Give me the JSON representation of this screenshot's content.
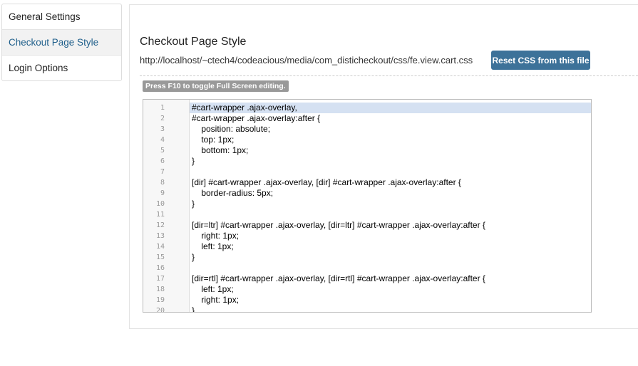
{
  "sidebar": {
    "items": [
      {
        "label": "General Settings",
        "active": false
      },
      {
        "label": "Checkout Page Style",
        "active": true
      },
      {
        "label": "Login Options",
        "active": false
      }
    ]
  },
  "main": {
    "title": "Checkout Page Style",
    "file_path": "http://localhost/~ctech4/codeacious/media/com_disticheckout/css/fe.view.cart.css",
    "reset_button_label": "Reset CSS from this file",
    "hint": "Press F10 to toggle Full Screen editing.",
    "editor": {
      "highlighted_line": 1,
      "lines": [
        {
          "number": "1",
          "text": "#cart-wrapper .ajax-overlay,"
        },
        {
          "number": "2",
          "text": "#cart-wrapper .ajax-overlay:after {"
        },
        {
          "number": "3",
          "text": "    position: absolute;"
        },
        {
          "number": "4",
          "text": "    top: 1px;"
        },
        {
          "number": "5",
          "text": "    bottom: 1px;"
        },
        {
          "number": "6",
          "text": "}"
        },
        {
          "number": "7",
          "text": ""
        },
        {
          "number": "8",
          "text": "[dir] #cart-wrapper .ajax-overlay, [dir] #cart-wrapper .ajax-overlay:after {"
        },
        {
          "number": "9",
          "text": "    border-radius: 5px;"
        },
        {
          "number": "10",
          "text": "}"
        },
        {
          "number": "11",
          "text": ""
        },
        {
          "number": "12",
          "text": "[dir=ltr] #cart-wrapper .ajax-overlay, [dir=ltr] #cart-wrapper .ajax-overlay:after {"
        },
        {
          "number": "13",
          "text": "    right: 1px;"
        },
        {
          "number": "14",
          "text": "    left: 1px;"
        },
        {
          "number": "15",
          "text": "}"
        },
        {
          "number": "16",
          "text": ""
        },
        {
          "number": "17",
          "text": "[dir=rtl] #cart-wrapper .ajax-overlay, [dir=rtl] #cart-wrapper .ajax-overlay:after {"
        },
        {
          "number": "18",
          "text": "    left: 1px;"
        },
        {
          "number": "19",
          "text": "    right: 1px;"
        },
        {
          "number": "20",
          "text": "}"
        }
      ]
    }
  },
  "colors": {
    "accent": "#3d7299",
    "active_link": "#1f5f8b",
    "line_highlight": "#d5e1f2",
    "hint_badge": "#999999"
  }
}
